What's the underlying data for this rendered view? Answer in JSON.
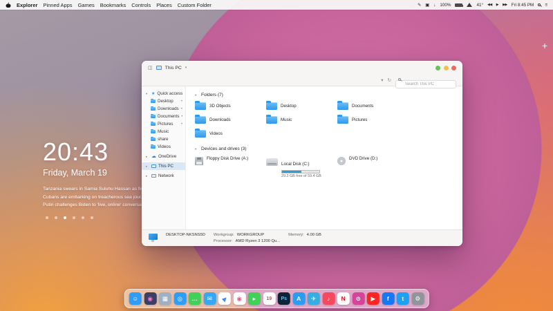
{
  "glyphs": {
    "chevron_down": "▾",
    "chevron_right": "▸",
    "panel": "◫",
    "refresh": "↻",
    "cloud": "☁",
    "star": "★",
    "pin": "•",
    "edit": "✎",
    "display": "▣",
    "download": "↓",
    "media_prev": "◀◀",
    "media_play": "▶",
    "media_next": "▶▶",
    "control_center": "≡",
    "plus": "+"
  },
  "menubar": {
    "menus": [
      "Explorer",
      "Pinned Apps",
      "Games",
      "Bookmarks",
      "Controls",
      "Places",
      "Custom Folder"
    ],
    "battery_percent": "100%",
    "temperature": "41°",
    "clock": "Fri 8:45 PM"
  },
  "widget": {
    "time": "20:43",
    "date": "Friday, March 19",
    "headlines": [
      "Tanzania swears in Samia Suluhu Hassan as fir...",
      "Cubans are embarking on treacherous sea jour...",
      "Putin challenges Biden to 'live, online' conversat..."
    ]
  },
  "explorer": {
    "title": "This PC",
    "search_placeholder": "Search This PC",
    "sidebar": {
      "quick_access_label": "Quick access",
      "quick_items": [
        {
          "label": "Desktop",
          "pinned": true
        },
        {
          "label": "Downloads",
          "pinned": true
        },
        {
          "label": "Documents",
          "pinned": true
        },
        {
          "label": "Pictures",
          "pinned": true
        },
        {
          "label": "Music",
          "pinned": false
        },
        {
          "label": "share",
          "pinned": false
        },
        {
          "label": "Videos",
          "pinned": false
        }
      ],
      "onedrive_label": "OneDrive",
      "this_pc_label": "This PC",
      "network_label": "Network"
    },
    "folders_section": {
      "label": "Folders (7)",
      "items": [
        "3D Objects",
        "Desktop",
        "Documents",
        "Downloads",
        "Music",
        "Pictures",
        "Videos"
      ]
    },
    "devices_section": {
      "label": "Devices and drives (3)",
      "floppy_name": "Floppy Disk Drive (A:)",
      "disk_name": "Local Disk (C:)",
      "disk_free": "29.2 GB free of 59.4 GB",
      "disk_used_width": "51%",
      "dvd_name": "DVD Drive (D:)"
    },
    "statusbar": {
      "device_name": "DESKTOP-NKSNS5D",
      "workgroup_label": "Workgroup:",
      "workgroup_value": "WORKGROUP",
      "memory_label": "Memory:",
      "memory_value": "4.00 GB",
      "processor_label": "Processor:",
      "processor_value": "AMD Ryzen 3 1200 Qu..."
    }
  },
  "dock": {
    "items": [
      {
        "name": "finder",
        "glyph": "☺",
        "bg": "#2e9df6"
      },
      {
        "name": "siri",
        "glyph": "◉",
        "bg": "#3b3f66",
        "fg": "#ff7bd1"
      },
      {
        "name": "launchpad",
        "glyph": "▦",
        "bg": "#9fb0c2"
      },
      {
        "name": "safari",
        "glyph": "◎",
        "bg": "#2f9df5"
      },
      {
        "name": "messages",
        "glyph": "…",
        "bg": "#3fd158"
      },
      {
        "name": "mail",
        "glyph": "✉",
        "bg": "#35a7f3"
      },
      {
        "name": "maps",
        "glyph": "▶",
        "bg": "#ffffff",
        "fg": "#4285f4"
      },
      {
        "name": "photos",
        "glyph": "◉",
        "bg": "#ffffff",
        "fg": "#e8567f"
      },
      {
        "name": "facetime",
        "glyph": "▸",
        "bg": "#3fd158"
      },
      {
        "name": "calendar",
        "glyph": "19",
        "bg": "#ffffff",
        "fg": "#e0483f"
      },
      {
        "name": "photoshop",
        "glyph": "Ps",
        "bg": "#0d2438",
        "fg": "#52c7ff"
      },
      {
        "name": "appstore",
        "glyph": "A",
        "bg": "#2b9cf2"
      },
      {
        "name": "telegram",
        "glyph": "✈",
        "bg": "#37aee2"
      },
      {
        "name": "music",
        "glyph": "♪",
        "bg": "#f8485e"
      },
      {
        "name": "netflix",
        "glyph": "N",
        "bg": "#ffffff",
        "fg": "#e50914"
      },
      {
        "name": "instagram",
        "glyph": "⊙",
        "bg": "#d6439a"
      },
      {
        "name": "youtube",
        "glyph": "▶",
        "bg": "#ff2424"
      },
      {
        "name": "facebook",
        "glyph": "f",
        "bg": "#1877f2"
      },
      {
        "name": "twitter",
        "glyph": "t",
        "bg": "#1da1f2"
      },
      {
        "name": "settings",
        "glyph": "⚙",
        "bg": "#90959b"
      }
    ]
  }
}
